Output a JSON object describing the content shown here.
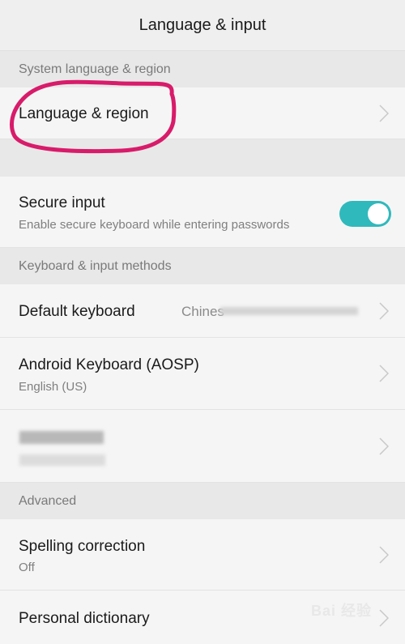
{
  "header": {
    "title": "Language & input"
  },
  "sections": {
    "system": {
      "label": "System language & region"
    },
    "keyboard": {
      "label": "Keyboard & input methods"
    },
    "advanced": {
      "label": "Advanced"
    }
  },
  "rows": {
    "language_region": {
      "title": "Language & region"
    },
    "secure_input": {
      "title": "Secure input",
      "subtitle": "Enable secure keyboard while entering passwords",
      "toggle_on": true
    },
    "default_keyboard": {
      "title": "Default keyboard",
      "value": "Chines"
    },
    "android_keyboard": {
      "title": "Android Keyboard (AOSP)",
      "subtitle": "English (US)"
    },
    "redacted_keyboard": {
      "title": "",
      "subtitle": ""
    },
    "spelling_correction": {
      "title": "Spelling correction",
      "subtitle": "Off"
    },
    "personal_dictionary": {
      "title": "Personal dictionary"
    }
  },
  "colors": {
    "accent": "#30b9bc",
    "annotation": "#d81b6a"
  },
  "watermark": {
    "text": "Bai 经验"
  }
}
